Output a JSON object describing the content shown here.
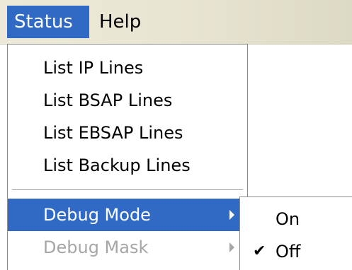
{
  "menubar": {
    "status_label": "Status",
    "help_label": "Help"
  },
  "status_menu": {
    "items": [
      {
        "label": "List IP Lines"
      },
      {
        "label": "List BSAP Lines"
      },
      {
        "label": "List EBSAP Lines"
      },
      {
        "label": "List Backup Lines"
      },
      {
        "label": "Debug Mode",
        "state": "highlighted",
        "submenu_icon": "submenu-arrow-icon"
      },
      {
        "label": "Debug Mask",
        "state": "disabled",
        "submenu_icon": "submenu-arrow-icon"
      }
    ]
  },
  "debug_mode_submenu": {
    "items": [
      {
        "label": "On",
        "checked": false
      },
      {
        "label": "Off",
        "checked": true,
        "check_glyph": "✔"
      }
    ]
  },
  "colors": {
    "highlight": "#316ac5",
    "disabled_text": "#a6a6a6",
    "menubar_bg": "#ece9d8"
  }
}
